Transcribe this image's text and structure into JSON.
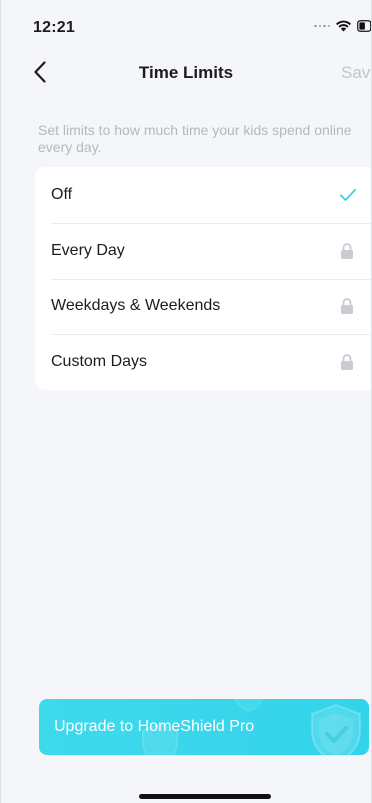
{
  "status_bar": {
    "time": "12:21"
  },
  "nav": {
    "title": "Time Limits",
    "save_label": "Save"
  },
  "description": "Set limits to how much time your kids spend online every day.",
  "options": [
    {
      "label": "Off",
      "state": "selected",
      "icon": "check-icon"
    },
    {
      "label": "Every Day",
      "state": "locked",
      "icon": "lock-icon"
    },
    {
      "label": "Weekdays & Weekends",
      "state": "locked",
      "icon": "lock-icon"
    },
    {
      "label": "Custom Days",
      "state": "locked",
      "icon": "lock-icon"
    }
  ],
  "upgrade": {
    "label": "Upgrade to HomeShield Pro"
  },
  "colors": {
    "accent": "#35d4ea",
    "background": "#f4f6f9",
    "disabled_text": "#c2c6cc"
  }
}
